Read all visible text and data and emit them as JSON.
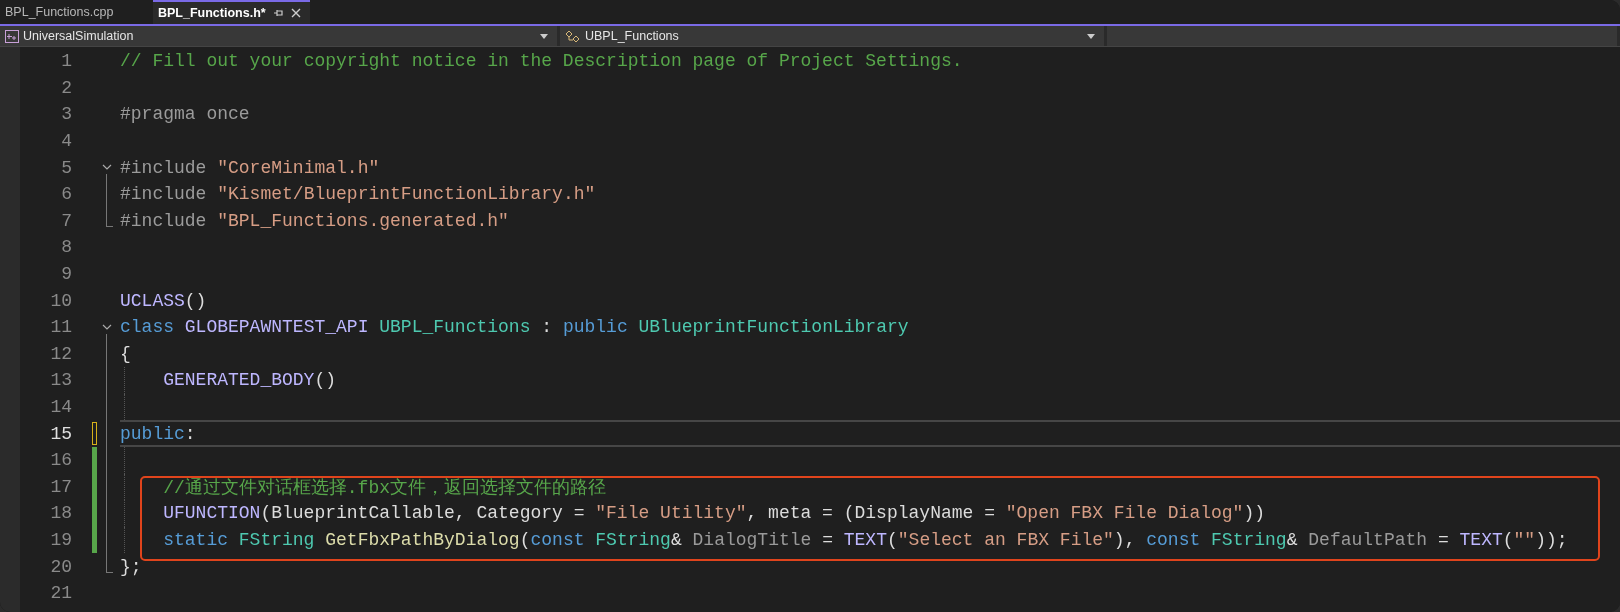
{
  "tabs": [
    {
      "label": "BPL_Functions.cpp",
      "selected": false
    },
    {
      "label": "BPL_Functions.h*",
      "selected": true
    }
  ],
  "nav_bar": {
    "project": "UniversalSimulation",
    "scope": "UBPL_Functions"
  },
  "editor": {
    "lines": [
      {
        "number": "1",
        "tokens": [
          {
            "kind": "comment",
            "text": "// Fill out your copyright notice in the Description page of Project Settings."
          }
        ]
      },
      {
        "number": "2"
      },
      {
        "number": "3",
        "tokens": [
          {
            "kind": "preproc",
            "text": "#pragma once"
          }
        ]
      },
      {
        "number": "4"
      },
      {
        "number": "5",
        "fold_expanded": true,
        "tokens": [
          {
            "kind": "preproc",
            "text": "#include "
          },
          {
            "kind": "string",
            "text": "\"CoreMinimal.h\""
          }
        ]
      },
      {
        "number": "6",
        "in_region": true,
        "tokens": [
          {
            "kind": "preproc",
            "text": "#include "
          },
          {
            "kind": "string",
            "text": "\"Kismet/BlueprintFunctionLibrary.h\""
          }
        ]
      },
      {
        "number": "7",
        "in_region": true,
        "region_end": true,
        "tokens": [
          {
            "kind": "preproc",
            "text": "#include "
          },
          {
            "kind": "string",
            "text": "\"BPL_Functions.generated.h\""
          }
        ]
      },
      {
        "number": "8"
      },
      {
        "number": "9"
      },
      {
        "number": "10",
        "tokens": [
          {
            "kind": "macro",
            "text": "UCLASS"
          },
          {
            "kind": "plain",
            "text": "()"
          }
        ]
      },
      {
        "number": "11",
        "fold_expanded": true,
        "tokens": [
          {
            "kind": "keyword",
            "text": "class "
          },
          {
            "kind": "macro",
            "text": "GLOBEPAWNTEST_API "
          },
          {
            "kind": "type",
            "text": "UBPL_Functions"
          },
          {
            "kind": "plain",
            "text": " : "
          },
          {
            "kind": "keyword",
            "text": "public "
          },
          {
            "kind": "type",
            "text": "UBlueprintFunctionLibrary"
          }
        ]
      },
      {
        "number": "12",
        "in_region": true,
        "tokens": [
          {
            "kind": "plain",
            "text": "{"
          }
        ]
      },
      {
        "number": "13",
        "in_region": true,
        "indent_guide": true,
        "tokens": [
          {
            "kind": "macro",
            "text": "GENERATED_BODY"
          },
          {
            "kind": "plain",
            "text": "()"
          }
        ]
      },
      {
        "number": "14",
        "in_region": true,
        "indent_guide": true
      },
      {
        "number": "15",
        "in_region": true,
        "current": true,
        "changed": true,
        "saved": false,
        "tokens": [
          {
            "kind": "keyword",
            "text": "public"
          },
          {
            "kind": "plain",
            "text": ":"
          }
        ]
      },
      {
        "number": "16",
        "in_region": true,
        "indent_guide": true,
        "changed": true,
        "saved": true
      },
      {
        "number": "17",
        "in_region": true,
        "indent_guide": true,
        "changed": true,
        "saved": true,
        "boxed": true,
        "tokens": [
          {
            "kind": "comment",
            "text": "//通过文件对话框选择.fbx文件，返回选择文件的路径"
          }
        ]
      },
      {
        "number": "18",
        "in_region": true,
        "indent_guide": true,
        "changed": true,
        "saved": true,
        "boxed": true,
        "tokens": [
          {
            "kind": "macro",
            "text": "UFUNCTION"
          },
          {
            "kind": "plain",
            "text": "(BlueprintCallable, Category = "
          },
          {
            "kind": "string",
            "text": "\"File Utility\""
          },
          {
            "kind": "plain",
            "text": ", meta = (DisplayName = "
          },
          {
            "kind": "string",
            "text": "\"Open FBX File Dialog\""
          },
          {
            "kind": "plain",
            "text": "))"
          }
        ]
      },
      {
        "number": "19",
        "in_region": true,
        "indent_guide": true,
        "changed": true,
        "saved": true,
        "boxed": true,
        "tokens": [
          {
            "kind": "keyword",
            "text": "static "
          },
          {
            "kind": "type",
            "text": "FString "
          },
          {
            "kind": "function",
            "text": "GetFbxPathByDialog"
          },
          {
            "kind": "plain",
            "text": "("
          },
          {
            "kind": "keyword",
            "text": "const "
          },
          {
            "kind": "type",
            "text": "FString"
          },
          {
            "kind": "plain",
            "text": "& "
          },
          {
            "kind": "param",
            "text": "DialogTitle"
          },
          {
            "kind": "plain",
            "text": " = "
          },
          {
            "kind": "macro",
            "text": "TEXT"
          },
          {
            "kind": "plain",
            "text": "("
          },
          {
            "kind": "string",
            "text": "\"Select an FBX File\""
          },
          {
            "kind": "plain",
            "text": "), "
          },
          {
            "kind": "keyword",
            "text": "const "
          },
          {
            "kind": "type",
            "text": "FString"
          },
          {
            "kind": "plain",
            "text": "& "
          },
          {
            "kind": "param",
            "text": "DefaultPath"
          },
          {
            "kind": "plain",
            "text": " = "
          },
          {
            "kind": "macro",
            "text": "TEXT"
          },
          {
            "kind": "plain",
            "text": "("
          },
          {
            "kind": "string",
            "text": "\"\""
          },
          {
            "kind": "plain",
            "text": "));"
          }
        ]
      },
      {
        "number": "20",
        "in_region": true,
        "region_end": true,
        "tokens": [
          {
            "kind": "plain",
            "text": "};"
          }
        ]
      },
      {
        "number": "21"
      }
    ]
  }
}
